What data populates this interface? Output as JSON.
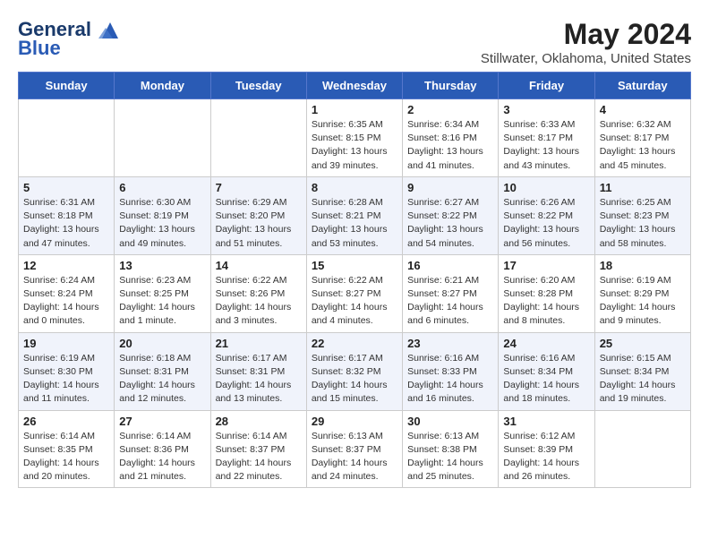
{
  "header": {
    "logo_line1": "General",
    "logo_line2": "Blue",
    "month_year": "May 2024",
    "location": "Stillwater, Oklahoma, United States"
  },
  "days_of_week": [
    "Sunday",
    "Monday",
    "Tuesday",
    "Wednesday",
    "Thursday",
    "Friday",
    "Saturday"
  ],
  "weeks": [
    [
      {
        "day": "",
        "sunrise": "",
        "sunset": "",
        "daylight": ""
      },
      {
        "day": "",
        "sunrise": "",
        "sunset": "",
        "daylight": ""
      },
      {
        "day": "",
        "sunrise": "",
        "sunset": "",
        "daylight": ""
      },
      {
        "day": "1",
        "sunrise": "Sunrise: 6:35 AM",
        "sunset": "Sunset: 8:15 PM",
        "daylight": "Daylight: 13 hours and 39 minutes."
      },
      {
        "day": "2",
        "sunrise": "Sunrise: 6:34 AM",
        "sunset": "Sunset: 8:16 PM",
        "daylight": "Daylight: 13 hours and 41 minutes."
      },
      {
        "day": "3",
        "sunrise": "Sunrise: 6:33 AM",
        "sunset": "Sunset: 8:17 PM",
        "daylight": "Daylight: 13 hours and 43 minutes."
      },
      {
        "day": "4",
        "sunrise": "Sunrise: 6:32 AM",
        "sunset": "Sunset: 8:17 PM",
        "daylight": "Daylight: 13 hours and 45 minutes."
      }
    ],
    [
      {
        "day": "5",
        "sunrise": "Sunrise: 6:31 AM",
        "sunset": "Sunset: 8:18 PM",
        "daylight": "Daylight: 13 hours and 47 minutes."
      },
      {
        "day": "6",
        "sunrise": "Sunrise: 6:30 AM",
        "sunset": "Sunset: 8:19 PM",
        "daylight": "Daylight: 13 hours and 49 minutes."
      },
      {
        "day": "7",
        "sunrise": "Sunrise: 6:29 AM",
        "sunset": "Sunset: 8:20 PM",
        "daylight": "Daylight: 13 hours and 51 minutes."
      },
      {
        "day": "8",
        "sunrise": "Sunrise: 6:28 AM",
        "sunset": "Sunset: 8:21 PM",
        "daylight": "Daylight: 13 hours and 53 minutes."
      },
      {
        "day": "9",
        "sunrise": "Sunrise: 6:27 AM",
        "sunset": "Sunset: 8:22 PM",
        "daylight": "Daylight: 13 hours and 54 minutes."
      },
      {
        "day": "10",
        "sunrise": "Sunrise: 6:26 AM",
        "sunset": "Sunset: 8:22 PM",
        "daylight": "Daylight: 13 hours and 56 minutes."
      },
      {
        "day": "11",
        "sunrise": "Sunrise: 6:25 AM",
        "sunset": "Sunset: 8:23 PM",
        "daylight": "Daylight: 13 hours and 58 minutes."
      }
    ],
    [
      {
        "day": "12",
        "sunrise": "Sunrise: 6:24 AM",
        "sunset": "Sunset: 8:24 PM",
        "daylight": "Daylight: 14 hours and 0 minutes."
      },
      {
        "day": "13",
        "sunrise": "Sunrise: 6:23 AM",
        "sunset": "Sunset: 8:25 PM",
        "daylight": "Daylight: 14 hours and 1 minute."
      },
      {
        "day": "14",
        "sunrise": "Sunrise: 6:22 AM",
        "sunset": "Sunset: 8:26 PM",
        "daylight": "Daylight: 14 hours and 3 minutes."
      },
      {
        "day": "15",
        "sunrise": "Sunrise: 6:22 AM",
        "sunset": "Sunset: 8:27 PM",
        "daylight": "Daylight: 14 hours and 4 minutes."
      },
      {
        "day": "16",
        "sunrise": "Sunrise: 6:21 AM",
        "sunset": "Sunset: 8:27 PM",
        "daylight": "Daylight: 14 hours and 6 minutes."
      },
      {
        "day": "17",
        "sunrise": "Sunrise: 6:20 AM",
        "sunset": "Sunset: 8:28 PM",
        "daylight": "Daylight: 14 hours and 8 minutes."
      },
      {
        "day": "18",
        "sunrise": "Sunrise: 6:19 AM",
        "sunset": "Sunset: 8:29 PM",
        "daylight": "Daylight: 14 hours and 9 minutes."
      }
    ],
    [
      {
        "day": "19",
        "sunrise": "Sunrise: 6:19 AM",
        "sunset": "Sunset: 8:30 PM",
        "daylight": "Daylight: 14 hours and 11 minutes."
      },
      {
        "day": "20",
        "sunrise": "Sunrise: 6:18 AM",
        "sunset": "Sunset: 8:31 PM",
        "daylight": "Daylight: 14 hours and 12 minutes."
      },
      {
        "day": "21",
        "sunrise": "Sunrise: 6:17 AM",
        "sunset": "Sunset: 8:31 PM",
        "daylight": "Daylight: 14 hours and 13 minutes."
      },
      {
        "day": "22",
        "sunrise": "Sunrise: 6:17 AM",
        "sunset": "Sunset: 8:32 PM",
        "daylight": "Daylight: 14 hours and 15 minutes."
      },
      {
        "day": "23",
        "sunrise": "Sunrise: 6:16 AM",
        "sunset": "Sunset: 8:33 PM",
        "daylight": "Daylight: 14 hours and 16 minutes."
      },
      {
        "day": "24",
        "sunrise": "Sunrise: 6:16 AM",
        "sunset": "Sunset: 8:34 PM",
        "daylight": "Daylight: 14 hours and 18 minutes."
      },
      {
        "day": "25",
        "sunrise": "Sunrise: 6:15 AM",
        "sunset": "Sunset: 8:34 PM",
        "daylight": "Daylight: 14 hours and 19 minutes."
      }
    ],
    [
      {
        "day": "26",
        "sunrise": "Sunrise: 6:14 AM",
        "sunset": "Sunset: 8:35 PM",
        "daylight": "Daylight: 14 hours and 20 minutes."
      },
      {
        "day": "27",
        "sunrise": "Sunrise: 6:14 AM",
        "sunset": "Sunset: 8:36 PM",
        "daylight": "Daylight: 14 hours and 21 minutes."
      },
      {
        "day": "28",
        "sunrise": "Sunrise: 6:14 AM",
        "sunset": "Sunset: 8:37 PM",
        "daylight": "Daylight: 14 hours and 22 minutes."
      },
      {
        "day": "29",
        "sunrise": "Sunrise: 6:13 AM",
        "sunset": "Sunset: 8:37 PM",
        "daylight": "Daylight: 14 hours and 24 minutes."
      },
      {
        "day": "30",
        "sunrise": "Sunrise: 6:13 AM",
        "sunset": "Sunset: 8:38 PM",
        "daylight": "Daylight: 14 hours and 25 minutes."
      },
      {
        "day": "31",
        "sunrise": "Sunrise: 6:12 AM",
        "sunset": "Sunset: 8:39 PM",
        "daylight": "Daylight: 14 hours and 26 minutes."
      },
      {
        "day": "",
        "sunrise": "",
        "sunset": "",
        "daylight": ""
      }
    ]
  ]
}
